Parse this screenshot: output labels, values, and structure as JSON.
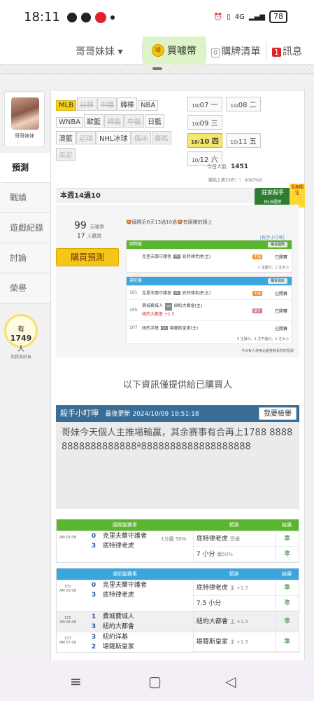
{
  "statusbar": {
    "time": "18:11",
    "battery": "78",
    "network": "4G"
  },
  "topnav": {
    "user": "哥哥妹妹 ▾",
    "buy_label": "買噱幣",
    "buy_coin": "噱",
    "list_count": "0",
    "list_label": "購牌清單",
    "msg_count": "1",
    "msg_label": "訊息"
  },
  "profile": {
    "name": "哥哥妹妹"
  },
  "sidebar": {
    "items": [
      {
        "label": "預測"
      },
      {
        "label": "戰績"
      },
      {
        "label": "遊戲紀錄"
      },
      {
        "label": "討論"
      },
      {
        "label": "榮譽"
      }
    ],
    "fans_count": "1749",
    "fans_unit": "人",
    "fans_prefix": "有",
    "fans_label": "加我為好友"
  },
  "leagues": [
    {
      "label": "MLB",
      "state": "on"
    },
    {
      "label": "日棒",
      "state": "off"
    },
    {
      "label": "中職",
      "state": "off"
    },
    {
      "label": "韓棒",
      "state": ""
    },
    {
      "label": "NBA",
      "state": ""
    },
    {
      "label": "WNBA",
      "state": ""
    },
    {
      "label": "歐籃",
      "state": ""
    },
    {
      "label": "韓籃",
      "state": "off"
    },
    {
      "label": "中籃",
      "state": "off"
    },
    {
      "label": "日籃",
      "state": ""
    },
    {
      "label": "澳籃",
      "state": ""
    },
    {
      "label": "足球",
      "state": "off"
    },
    {
      "label": "NHL冰球",
      "state": ""
    },
    {
      "label": "俄冰",
      "state": "off"
    },
    {
      "label": "賽馬",
      "state": "off"
    },
    {
      "label": "美足",
      "state": "off"
    }
  ],
  "dates": [
    {
      "m": "10/",
      "d": "07 一",
      "on": false
    },
    {
      "m": "10/",
      "d": "08 二",
      "on": false
    },
    {
      "m": "10/",
      "d": "09 三",
      "on": false
    },
    {
      "m": "10/",
      "d": "10 四",
      "on": true
    },
    {
      "m": "10/",
      "d": "11 五",
      "on": false
    },
    {
      "m": "10/",
      "d": "12 六",
      "on": false
    }
  ],
  "viewers": {
    "label": "今日人氣",
    "count": "1451"
  },
  "rank_line": "屬話上第33名！！ 0097%8",
  "week": {
    "title": "本週14過10",
    "award_line1": "莊家殺手",
    "award_line2": "MLB週榜",
    "award_tag": "長期關注"
  },
  "stats": {
    "money": "99",
    "money_unit": "元噱幣",
    "people": "17",
    "people_unit": "人購買",
    "buy_label": "購買預測",
    "streak": "🤩國際近6天13過10過🤩有跟賭的跟上",
    "mini_link": "[殺手小叮嚀]"
  },
  "mini_intl": {
    "header": "國際盤",
    "btn": "購買國際",
    "rows": [
      {
        "id": "",
        "away": "克里夫蘭守護者",
        "home": "底特律老虎(主)",
        "tag": "不讓",
        "status": "已開賽"
      }
    ],
    "foot": "1 注讓分、1 注大小"
  },
  "mini_tw": {
    "header": "運彩盤",
    "btn": "購買運彩",
    "rows": [
      {
        "id": "101",
        "away": "克里夫蘭守護者",
        "home": "底特律老虎(主)",
        "tag": "不讓",
        "status": "已開賽"
      },
      {
        "id": "105",
        "away": "費城費城人",
        "home": "紐約大都會(主)",
        "sub": "紐約大都會 +1.5",
        "tag": "讓分",
        "status": "已開賽"
      },
      {
        "id": "107",
        "away": "紐約洋基",
        "home": "堪薩斯皇家(主)",
        "tag": "",
        "status": "已開賽"
      }
    ],
    "foot": "3 注讓分、1 注不讓分、1 注大小",
    "note": "今日有人使用北銀券觀看您的預測"
  },
  "buyer_note": "以下資訊僅提供給已購買人",
  "tip": {
    "title": "殺手小叮嚀",
    "updated_label": "最後更新",
    "updated": "2024/10/09 18:51:18",
    "btn": "我要檢舉",
    "text": "哥妹今天個人主推場輸贏，其余赛事有合再上1788 88888888888888888ª8888888888888888888"
  },
  "table_intl": {
    "head_game": "國際盤賽事",
    "head_pred": "預測",
    "head_res": "結果",
    "rows": [
      {
        "time": "AM 03:08",
        "away_score": "0",
        "away": "克里夫蘭守護者",
        "home_score": "3",
        "home": "底特律老虎",
        "spread": "1分贏 50%",
        "pred1": "底特律老虎",
        "pred1_note": "受讓",
        "pred2": "7 小分",
        "pred2_note": "贏50%",
        "res1": "準",
        "res2": "準"
      }
    ]
  },
  "table_tw": {
    "head_game": "運彩盤賽事",
    "head_pred": "預測",
    "head_res": "結果",
    "rows": [
      {
        "id": "101",
        "time": "AM 03:08",
        "away_score": "0",
        "away": "克里夫蘭守護者",
        "home_score": "3",
        "home": "底特律老虎",
        "pred1": "底特律老虎",
        "pred1_note": "主 +1.5",
        "pred2": "7.5 小分",
        "res1": "準",
        "res2": "準"
      },
      {
        "id": "105",
        "time": "AM 08:08",
        "away_score": "1",
        "away": "費城費城人",
        "home_score": "3",
        "home": "紐約大都會",
        "pred1": "紐約大都會",
        "pred1_note": "主 +1.5",
        "res1": "準"
      },
      {
        "id": "107",
        "time": "AM 07:08",
        "away_score": "3",
        "away": "紐約洋基",
        "home_score": "2",
        "home": "堪薩斯皇家",
        "pred1": "堪薩斯皇家",
        "pred1_note": "主 +1.5",
        "res1": "準"
      }
    ]
  },
  "colors": {
    "green_header": "#5cb531",
    "blue_header": "#3aa6dd",
    "tip_header": "#3a6d96",
    "accent_yellow": "#f5c518"
  },
  "bottomnav": {
    "menu": "≡",
    "home": "▢",
    "back": "◁"
  }
}
